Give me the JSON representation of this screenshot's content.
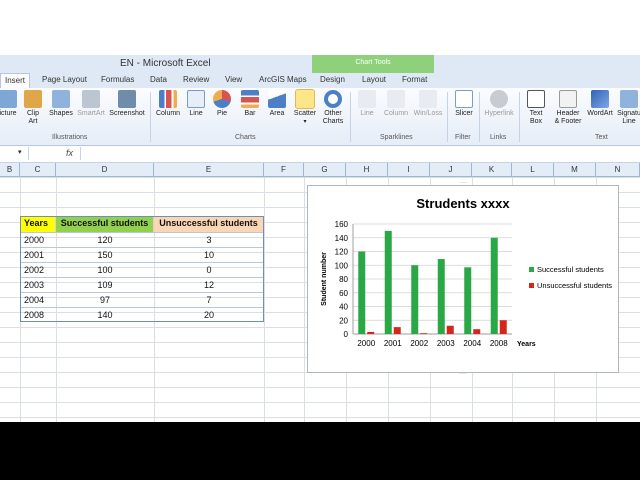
{
  "window": {
    "title": "EN  -  Microsoft Excel"
  },
  "chart_tools_label": "Chart Tools",
  "tabs": [
    {
      "label": "Insert",
      "active": true
    },
    {
      "label": "Page Layout"
    },
    {
      "label": "Formulas"
    },
    {
      "label": "Data"
    },
    {
      "label": "Review"
    },
    {
      "label": "View"
    },
    {
      "label": "ArcGIS Maps"
    },
    {
      "label": "Design"
    },
    {
      "label": "Layout"
    },
    {
      "label": "Format"
    }
  ],
  "ribbon": {
    "buttons": [
      {
        "label": "icture",
        "icon": "picture-icon"
      },
      {
        "label": "Clip\nArt",
        "icon": "clip-art-icon"
      },
      {
        "label": "Shapes",
        "icon": "shapes-icon"
      },
      {
        "label": "SmartArt",
        "icon": "smartart-icon",
        "disabled": true
      },
      {
        "label": "Screenshot",
        "icon": "screenshot-icon"
      },
      {
        "label": "Column",
        "icon": "column-chart-icon"
      },
      {
        "label": "Line",
        "icon": "line-chart-icon"
      },
      {
        "label": "Pie",
        "icon": "pie-chart-icon"
      },
      {
        "label": "Bar",
        "icon": "bar-chart-icon"
      },
      {
        "label": "Area",
        "icon": "area-chart-icon"
      },
      {
        "label": "Scatter",
        "icon": "scatter-chart-icon",
        "selected": true
      },
      {
        "label": "Other\nCharts",
        "icon": "other-charts-icon"
      },
      {
        "label": "Line",
        "icon": "sparkline-line-icon",
        "disabled": true
      },
      {
        "label": "Column",
        "icon": "sparkline-column-icon",
        "disabled": true
      },
      {
        "label": "Win/Loss",
        "icon": "sparkline-winloss-icon",
        "disabled": true
      },
      {
        "label": "Slicer",
        "icon": "slicer-icon"
      },
      {
        "label": "Hyperlink",
        "icon": "hyperlink-icon",
        "disabled": true
      },
      {
        "label": "Text\nBox",
        "icon": "text-box-icon"
      },
      {
        "label": "Header\n& Footer",
        "icon": "header-footer-icon"
      },
      {
        "label": "WordArt",
        "icon": "wordart-icon"
      },
      {
        "label": "Signatu\nLine",
        "icon": "signature-line-icon"
      }
    ],
    "groups": [
      "Illustrations",
      "Charts",
      "Sparklines",
      "Filter",
      "Links",
      "Text"
    ]
  },
  "formula_bar": {
    "fx_label": "fx",
    "value": ""
  },
  "columns": [
    "B",
    "C",
    "D",
    "E",
    "F",
    "G",
    "H",
    "I",
    "J",
    "K",
    "L",
    "M",
    "N"
  ],
  "table": {
    "headers": [
      "Years",
      "Successful students",
      "Unsuccessful students"
    ],
    "rows": [
      [
        "2000",
        "120",
        "3"
      ],
      [
        "2001",
        "150",
        "10"
      ],
      [
        "2002",
        "100",
        "0"
      ],
      [
        "2003",
        "109",
        "12"
      ],
      [
        "2004",
        "97",
        "7"
      ],
      [
        "2008",
        "140",
        "20"
      ]
    ],
    "colors": {
      "years_header": "#ffff00",
      "success_header": "#92d050",
      "unsuccess_header": "#fcd5b4"
    }
  },
  "chart_data": {
    "type": "bar",
    "title": "Strudents xxxx",
    "xlabel": "Years",
    "ylabel": "Student number",
    "categories": [
      "2000",
      "2001",
      "2002",
      "2003",
      "2004",
      "2008"
    ],
    "series": [
      {
        "name": "Successful students",
        "values": [
          120,
          150,
          100,
          109,
          97,
          140
        ],
        "color": "#2aa845"
      },
      {
        "name": "Unsuccessful students",
        "values": [
          3,
          10,
          0,
          12,
          7,
          20
        ],
        "color": "#d4261c"
      }
    ],
    "ylim": [
      0,
      160
    ],
    "yticks": [
      0,
      20,
      40,
      60,
      80,
      100,
      120,
      140,
      160
    ],
    "grid": true,
    "legend": "right"
  }
}
